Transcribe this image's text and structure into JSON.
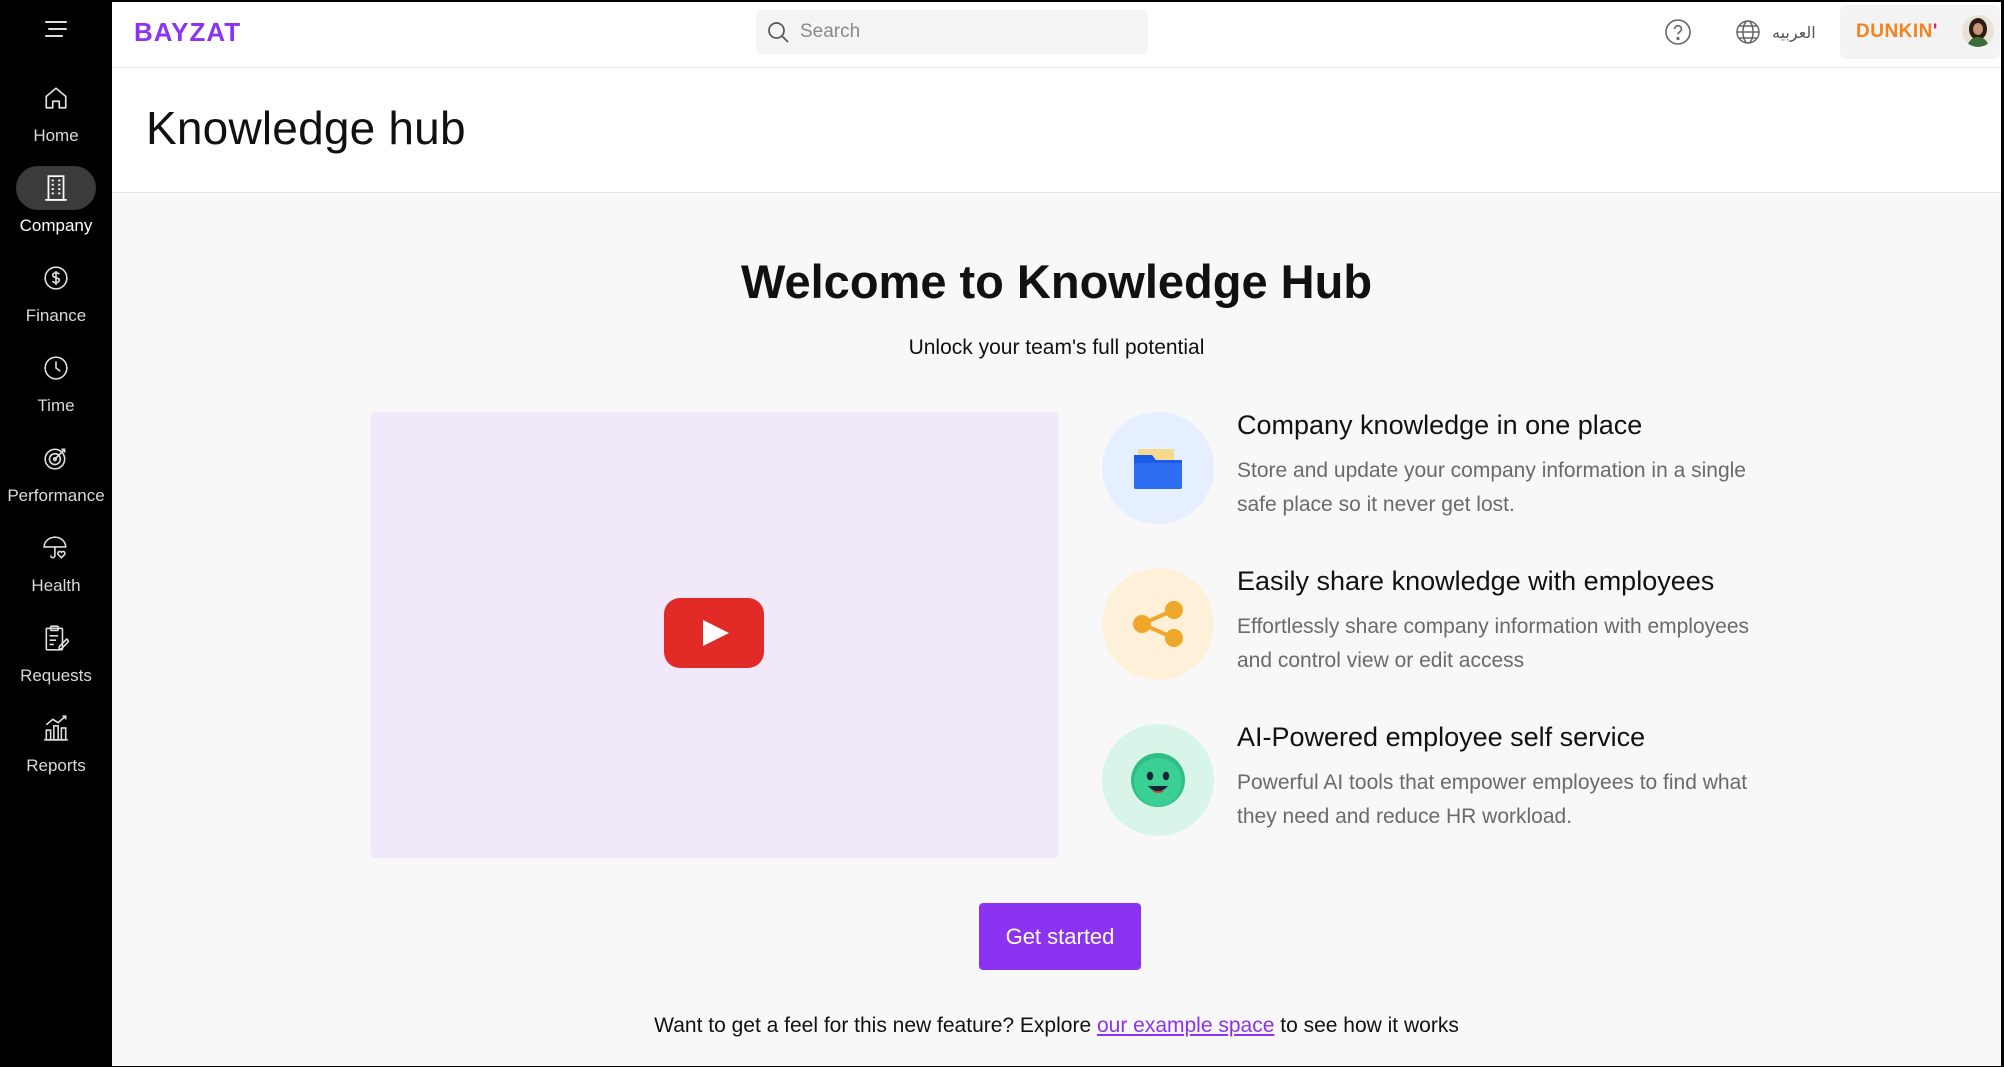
{
  "brand": {
    "logo_text": "BAYZAT",
    "accent": "#8c33f2"
  },
  "topbar": {
    "search_placeholder": "Search",
    "language_label": "العربيه",
    "company_name": "DUNKIN",
    "company_mark": "'"
  },
  "sidebar": {
    "items": [
      {
        "label": "Home",
        "icon": "home-icon"
      },
      {
        "label": "Company",
        "icon": "building-icon",
        "active": true
      },
      {
        "label": "Finance",
        "icon": "dollar-circle-icon"
      },
      {
        "label": "Time",
        "icon": "clock-icon"
      },
      {
        "label": "Performance",
        "icon": "target-icon"
      },
      {
        "label": "Health",
        "icon": "umbrella-heart-icon"
      },
      {
        "label": "Requests",
        "icon": "clipboard-edit-icon"
      },
      {
        "label": "Reports",
        "icon": "bar-chart-icon"
      }
    ]
  },
  "page": {
    "title": "Knowledge hub"
  },
  "welcome": {
    "title": "Welcome to Knowledge Hub",
    "subtitle": "Unlock your team's full potential"
  },
  "features": [
    {
      "title": "Company knowledge in one place",
      "description": "Store and update your company information in a single safe place so it never get lost.",
      "icon": "folder-icon",
      "circle_color": "#e6efff"
    },
    {
      "title": "Easily share knowledge with employees",
      "description": "Effortlessly share company information with employees and control view or edit access",
      "icon": "share-icon",
      "circle_color": "#fff1d9"
    },
    {
      "title": "AI-Powered employee self service",
      "description": "Powerful AI tools that empower employees to find what they need and reduce HR workload.",
      "icon": "smiley-face-icon",
      "circle_color": "#d9f5ea"
    }
  ],
  "cta": {
    "label": "Get started"
  },
  "footer": {
    "prefix": "Want to get a feel for this new feature? Explore ",
    "link_text": "our example space",
    "suffix": " to see how it works"
  }
}
